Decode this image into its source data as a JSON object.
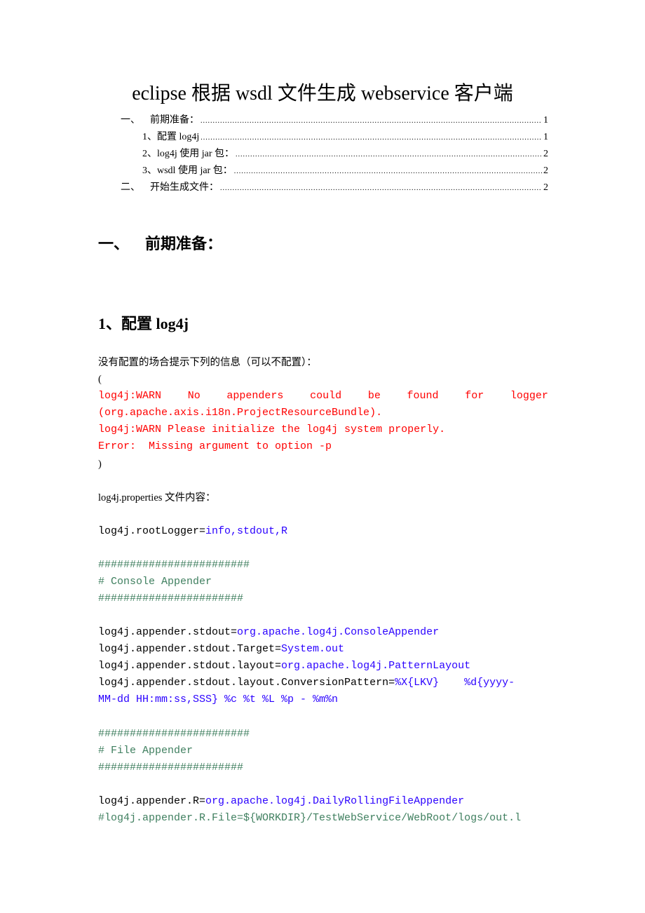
{
  "document": {
    "title": "eclipse 根据 wsdl 文件生成 webservice 客户端",
    "toc": [
      {
        "num": "一、",
        "text": "前期准备：",
        "page": "1",
        "level": 1
      },
      {
        "num": "1、",
        "text": "配置 log4j",
        "page": "1",
        "level": 2
      },
      {
        "num": "2、",
        "text": "log4j 使用 jar 包：",
        "page": "2",
        "level": 2
      },
      {
        "num": "3、",
        "text": "wsdl 使用 jar 包：",
        "page": "2",
        "level": 2
      },
      {
        "num": "二、",
        "text": "开始生成文件：",
        "page": "2",
        "level": 1
      }
    ],
    "toc_leader": "....................................................................................................................................................................................................",
    "section1_heading": "一、   前期准备：",
    "section1_1_heading": "1、配置 log4j",
    "intro_text": "没有配置的场合提示下列的信息（可以不配置）：",
    "open_paren": "(",
    "close_paren": ")",
    "warn_line1_words": [
      "log4j:WARN",
      "No",
      "appenders",
      "could",
      "be",
      "found",
      "for",
      "logger"
    ],
    "warn_line2": "(org.apache.axis.i18n.ProjectResourceBundle).",
    "warn_line3": "log4j:WARN Please initialize the log4j system properly.",
    "error_line": "Error:  Missing argument to option -p",
    "properties_label": "log4j.properties 文件内容：",
    "code": {
      "root_key": "log4j.rootLogger=",
      "root_val": "info,stdout,R",
      "hash_long": "########################",
      "hash_short": "#######################",
      "console_comment": "# Console Appender",
      "stdout_key": "log4j.appender.stdout=",
      "stdout_val": "org.apache.log4j.ConsoleAppender",
      "target_key": "log4j.appender.stdout.Target=",
      "target_val": "System.out",
      "layout_key": "log4j.appender.stdout.layout=",
      "layout_val": "org.apache.log4j.PatternLayout",
      "pattern_key": "log4j.appender.stdout.layout.ConversionPattern=",
      "pattern_val1": "%X{LKV}    %d{yyyy-",
      "pattern_val2": "MM-dd HH:mm:ss,SSS} %c %t %L %p - %m%n",
      "file_comment": "# File Appender",
      "r_key": "log4j.appender.R=",
      "r_val": "org.apache.log4j.DailyRollingFileAppender",
      "r_file_comment": "#log4j.appender.R.File=${WORKDIR}/TestWebService/WebRoot/logs/out.l"
    }
  }
}
